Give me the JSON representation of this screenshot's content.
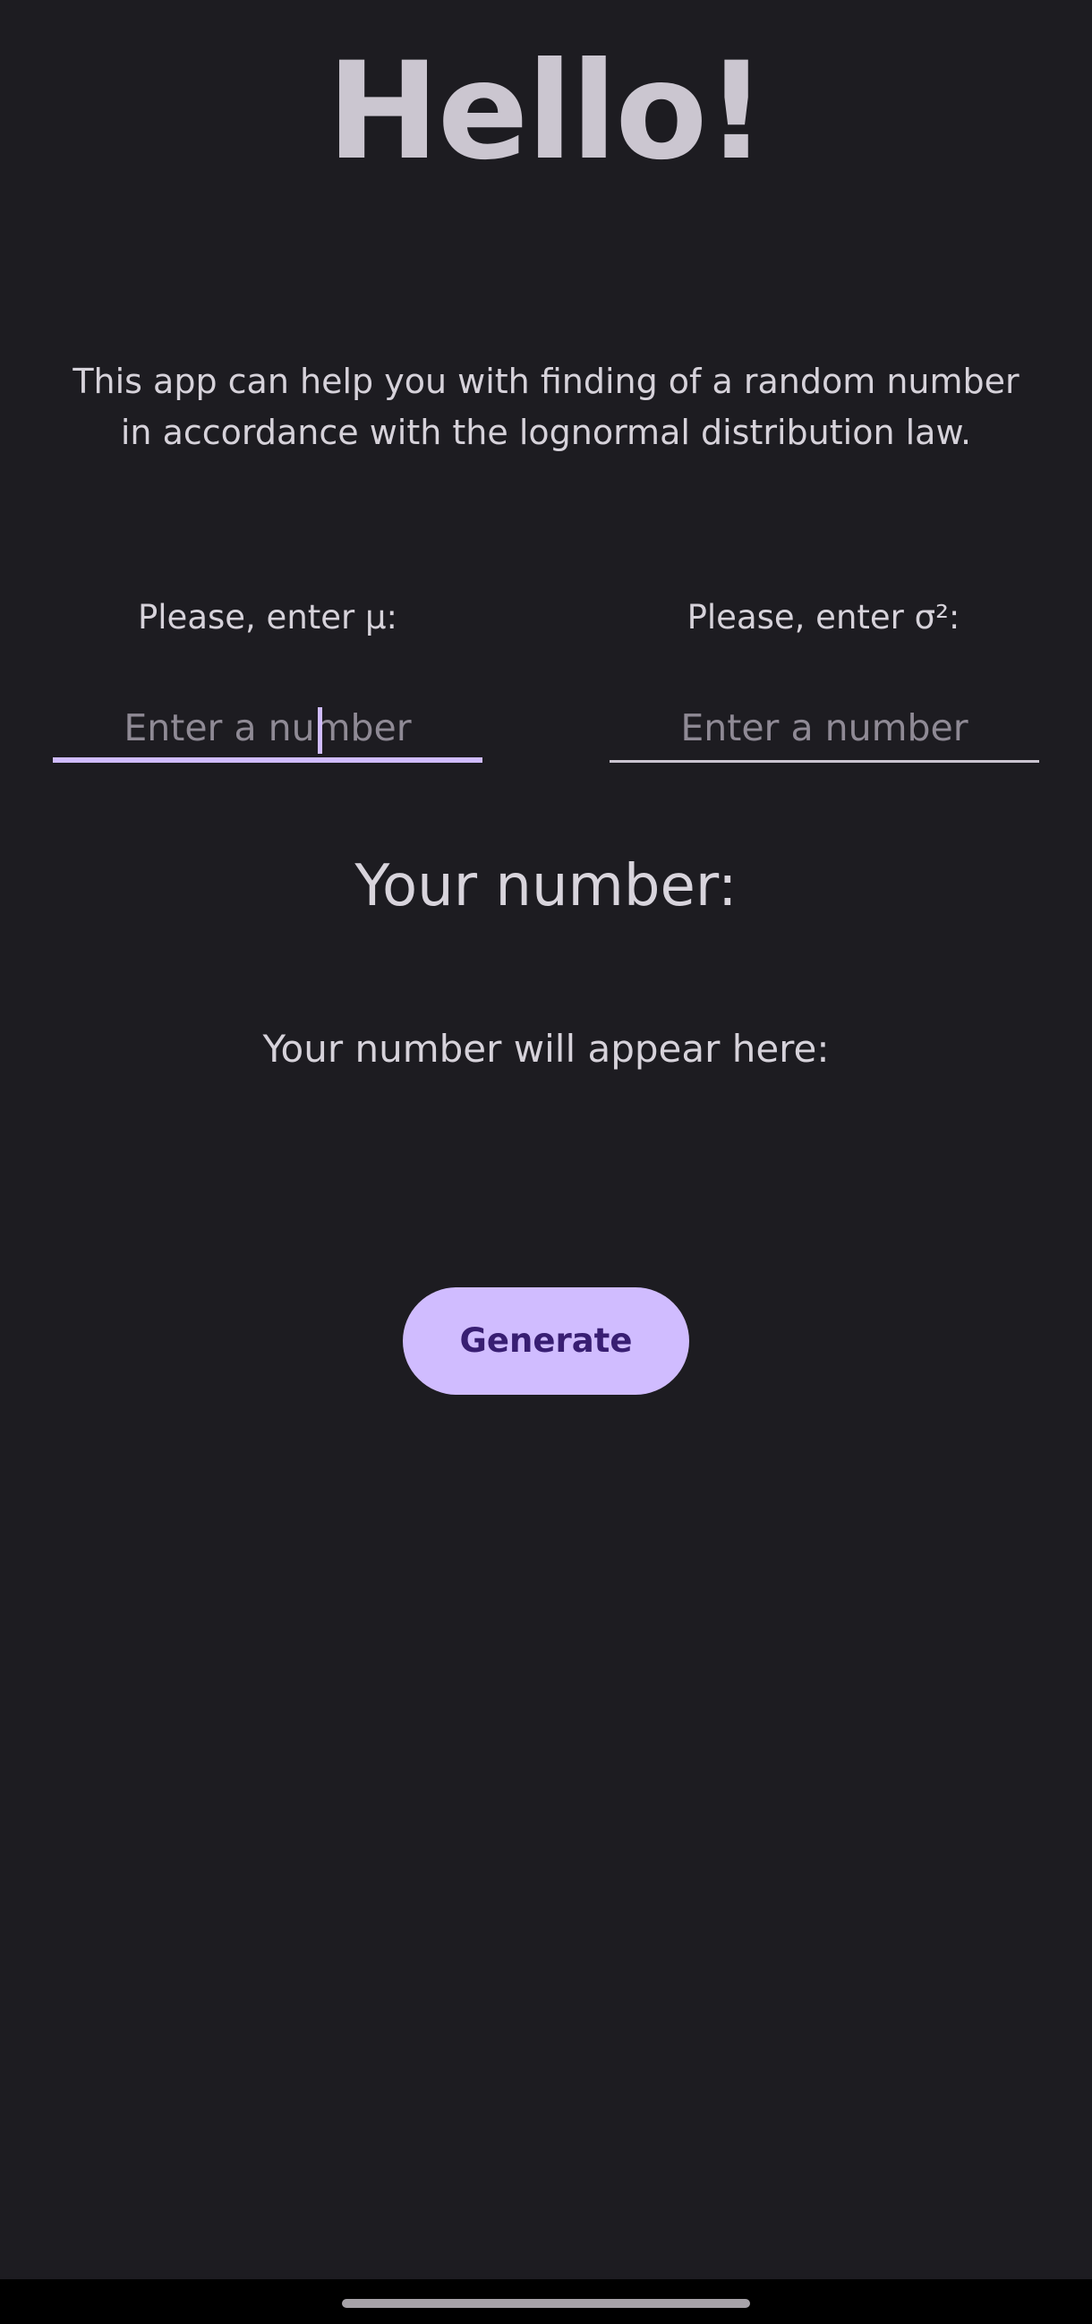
{
  "title": "Hello!",
  "description": "This app can help you with finding of a random number in accordance with the lognormal distribution law.",
  "inputs": {
    "mu": {
      "label": "Please, enter μ:",
      "placeholder": "Enter a number",
      "value": ""
    },
    "sigma": {
      "label": "Please, enter σ²:",
      "placeholder": "Enter a number",
      "value": ""
    }
  },
  "result": {
    "heading": "Your number:",
    "text": "Your number will appear here:"
  },
  "generate_button": {
    "label": "Generate"
  },
  "colors": {
    "background": "#1d1c21",
    "accent": "#d0bcff",
    "button_text": "#381e72",
    "text": "#d6d2da"
  }
}
